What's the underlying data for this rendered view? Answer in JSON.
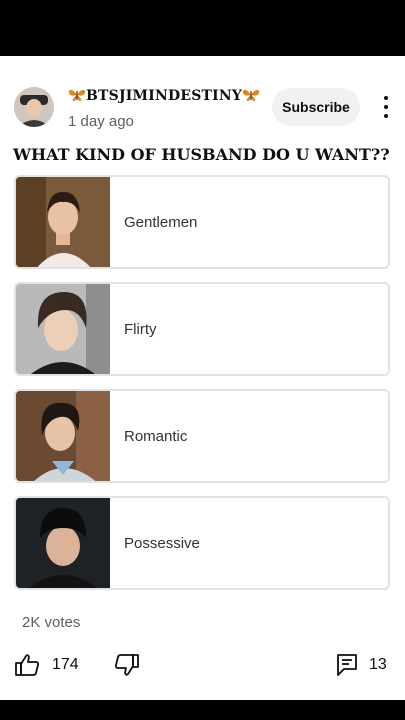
{
  "post": {
    "channel_name": "BTSJIMINDESTINY",
    "time_ago": "1 day ago",
    "subscribe_label": "Subscribe",
    "question": "WHAT KIND OF HUSBAND DO U WANT??"
  },
  "options": [
    {
      "label": "Gentlemen"
    },
    {
      "label": "Flirty"
    },
    {
      "label": "Romantic"
    },
    {
      "label": "Possessive"
    }
  ],
  "votes_text": "2K votes",
  "actions": {
    "like_count": "174",
    "comment_count": "13"
  },
  "colors": {
    "butterfly": "#d9892a",
    "secondary_text": "#606060",
    "subscribe_bg": "#f1f1f1"
  }
}
